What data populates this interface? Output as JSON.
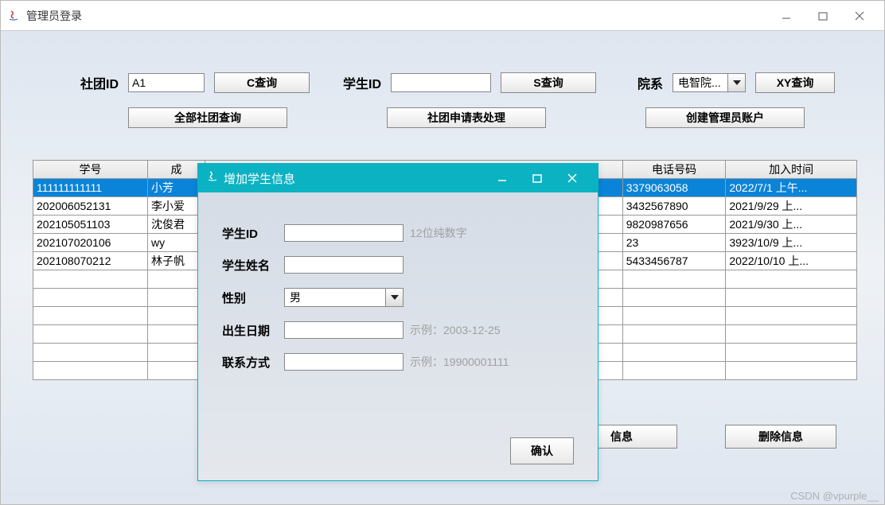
{
  "main_window": {
    "title": "管理员登录",
    "club_id_label": "社团ID",
    "club_id_value": "A1",
    "c_query_btn": "C查询",
    "student_id_label": "学生ID",
    "student_id_value": "",
    "s_query_btn": "S查询",
    "dept_label": "院系",
    "dept_selected": "电智院...",
    "xy_query_btn": "XY查询",
    "all_clubs_btn": "全部社团查询",
    "apply_process_btn": "社团申请表处理",
    "create_admin_btn": "创建管理员账户",
    "info_btn_partial": "信息",
    "delete_info_btn": "删除信息"
  },
  "table": {
    "headers": [
      "学号",
      "成",
      "电话号码",
      "加入时间"
    ],
    "rows": [
      {
        "id": "111111111111",
        "name": "小芳",
        "phone": "3379063058",
        "date": "2022/7/1 上午...",
        "selected": true
      },
      {
        "id": "202006052131",
        "name": "李小爱",
        "phone": "3432567890",
        "date": "2021/9/29 上...",
        "selected": false
      },
      {
        "id": "202105051103",
        "name": "沈俊君",
        "phone": "9820987656",
        "date": "2021/9/30 上...",
        "selected": false
      },
      {
        "id": "202107020106",
        "name": "wy",
        "phone": "23",
        "date": "3923/10/9 上...",
        "selected": false
      },
      {
        "id": "202108070212",
        "name": "林子帆",
        "phone": "5433456787",
        "date": "2022/10/10 上...",
        "selected": false
      }
    ],
    "empty_rows": 6
  },
  "dialog": {
    "title": "增加学生信息",
    "fields": {
      "student_id": {
        "label": "学生ID",
        "value": "",
        "hint": "12位纯数字"
      },
      "name": {
        "label": "学生姓名",
        "value": "",
        "hint": ""
      },
      "gender": {
        "label": "性别",
        "value": "男",
        "hint": ""
      },
      "birth": {
        "label": "出生日期",
        "value": "",
        "hint": "示例：2003-12-25"
      },
      "contact": {
        "label": "联系方式",
        "value": "",
        "hint": "示例：19900001111"
      }
    },
    "confirm_btn": "确认"
  },
  "watermark": "CSDN @vpurple__"
}
